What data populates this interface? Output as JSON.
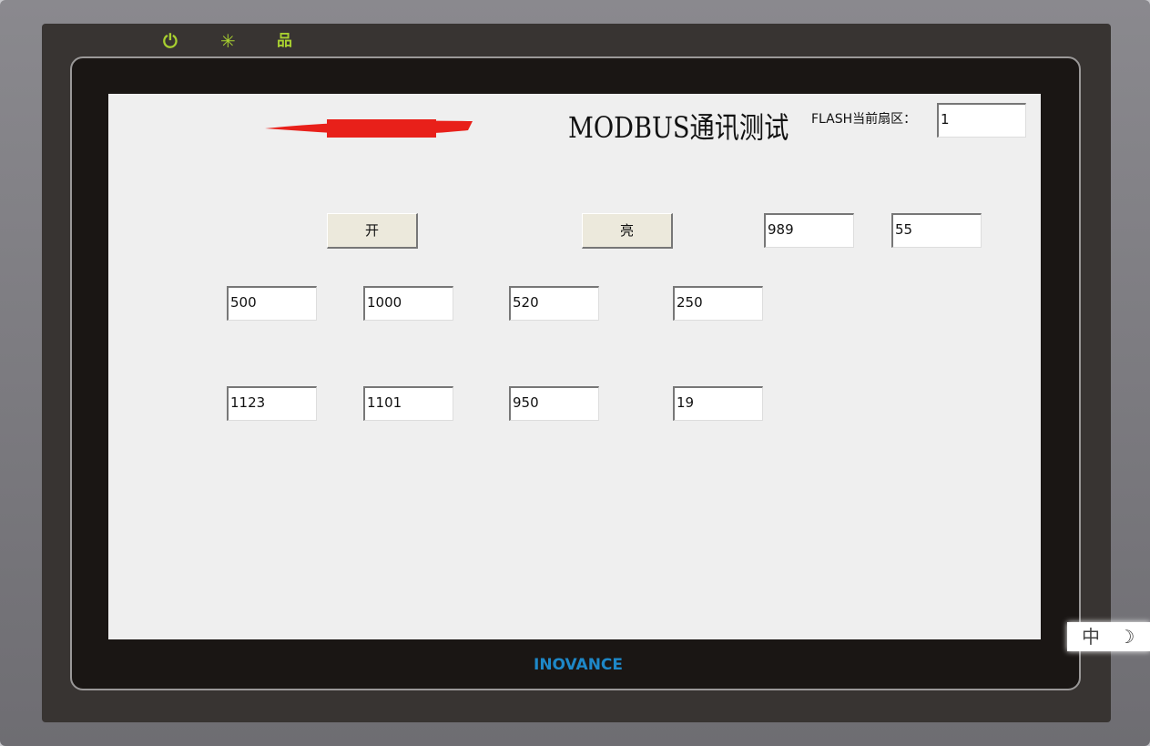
{
  "device": {
    "brand": "INOVANCE",
    "leds": [
      "power-icon",
      "activity-icon",
      "network-icon"
    ]
  },
  "screen": {
    "title": "MODBUS通讯测试",
    "flash_label": "FLASH当前扇区：",
    "flash_value": "1",
    "buttons": {
      "open": "开",
      "bright": "亮"
    },
    "top_values": [
      "989",
      "55"
    ],
    "row1": [
      "500",
      "1000",
      "520",
      "250"
    ],
    "row2": [
      "1123",
      "1101",
      "950",
      "19"
    ]
  },
  "ime": {
    "mode": "中",
    "icon": "☽"
  }
}
